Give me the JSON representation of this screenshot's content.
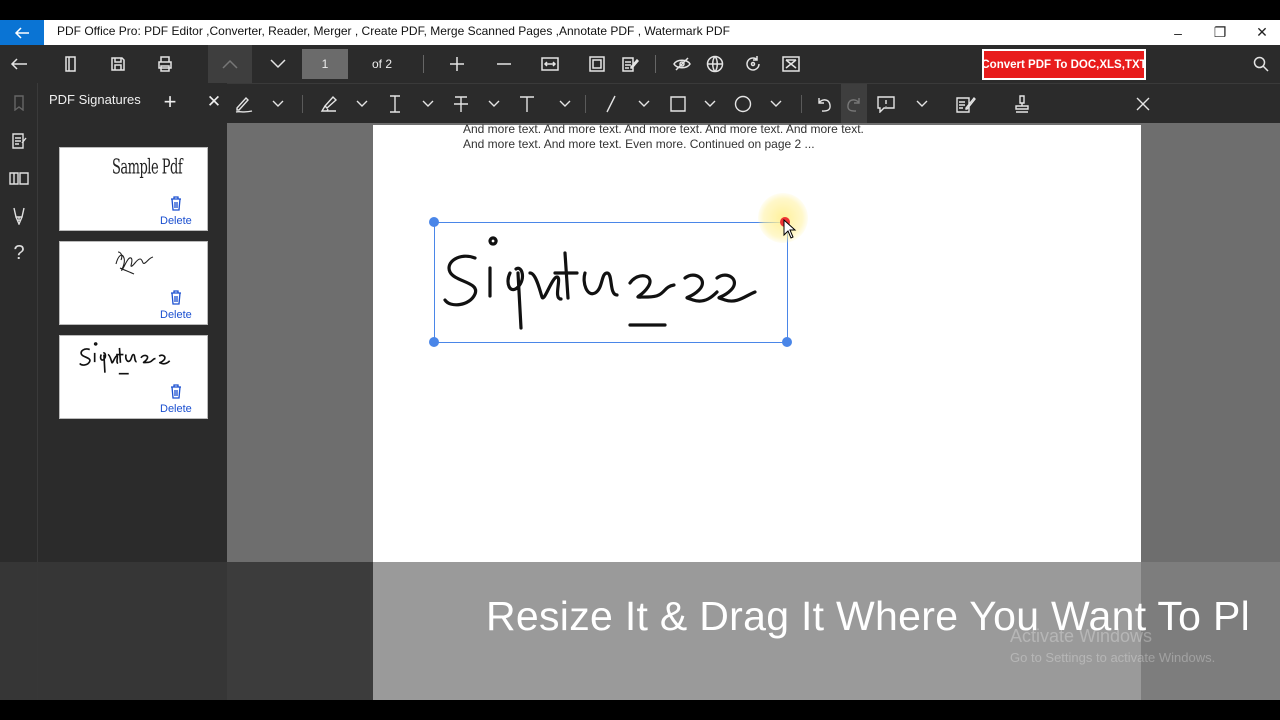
{
  "window": {
    "title": "PDF Office Pro: PDF Editor ,Converter, Reader, Merger , Create PDF, Merge Scanned Pages ,Annotate PDF , Watermark PDF",
    "back_icon": "back-arrow-icon",
    "minimize": "–",
    "restore": "❐",
    "close": "✕"
  },
  "toolbar": {
    "page_number": "1",
    "page_of": "of 2",
    "convert_label": "Convert PDF To DOC,XLS,TXT",
    "convert_color": "#e81c1c"
  },
  "signature_panel": {
    "title": "PDF Signatures",
    "add": "+",
    "close": "✕",
    "cards": [
      {
        "preview": "Sample Pdf",
        "delete_label": "Delete"
      },
      {
        "preview": "",
        "delete_label": "Delete"
      },
      {
        "preview": "Signature",
        "delete_label": "Delete"
      }
    ]
  },
  "document": {
    "text": "And more text. And more text. And more text. And more text. And more text. And more text. And more text. Even more. Continued on page 2 ..."
  },
  "caption": "Resize It & Drag It Where You Want To Pl",
  "watermark": {
    "line1": "Activate Windows",
    "line2": "Go to Settings to activate Windows."
  },
  "colors": {
    "accent_blue": "#0a74d4",
    "selection_blue": "#4a86e8",
    "link_blue": "#1a4fd0"
  }
}
